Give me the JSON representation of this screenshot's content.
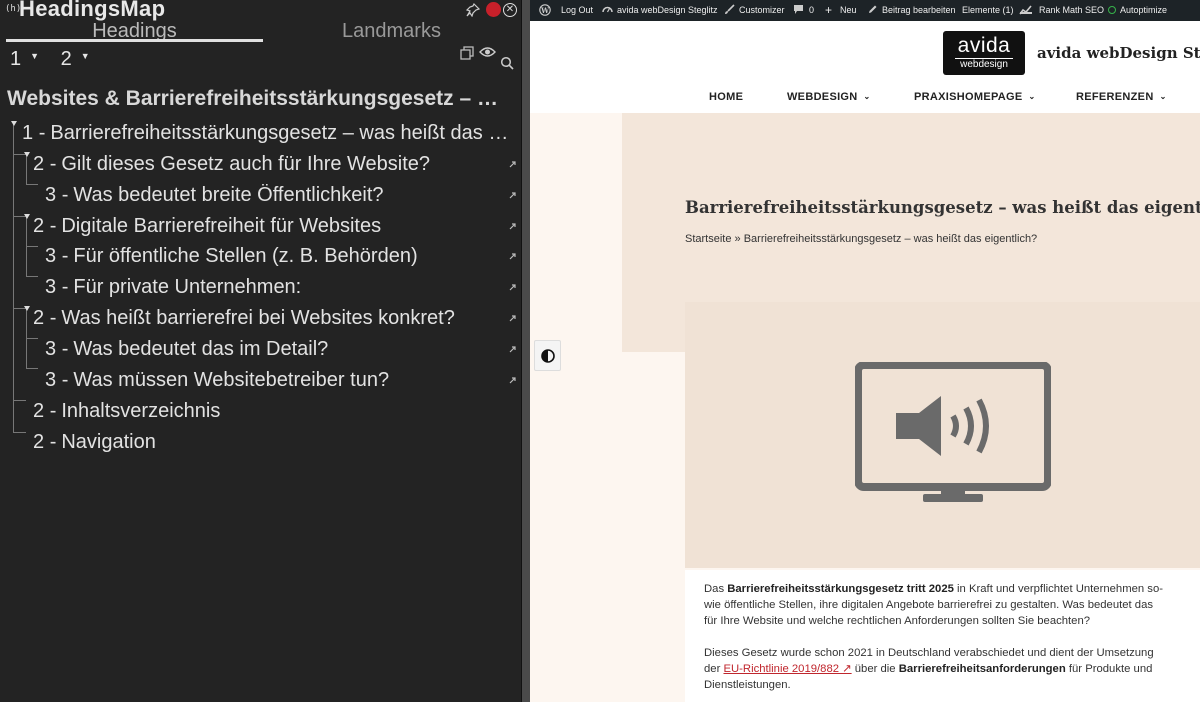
{
  "headingsmap": {
    "title": "HeadingsMap",
    "logo_text": "(h)",
    "tabs": [
      {
        "label": "Headings",
        "active": true
      },
      {
        "label": "Landmarks",
        "active": false
      }
    ],
    "level_buttons": [
      "1",
      "2"
    ],
    "document_title": "Websites & Barrierefreiheitsstärkungsgesetz – Was bedeutet das?",
    "headings": [
      {
        "level": "1",
        "text": "Barrierefreiheitsstärkungsgesetz – was heißt das eigentlich?"
      },
      {
        "level": "2",
        "text": "Gilt dieses Gesetz auch für Ihre Website?"
      },
      {
        "level": "3",
        "text": "Was bedeutet breite Öffentlichkeit?"
      },
      {
        "level": "2",
        "text": "Digitale Barrierefreiheit für Websites"
      },
      {
        "level": "3",
        "text": "Für öffentliche Stellen (z. B. Behörden)"
      },
      {
        "level": "3",
        "text": "Für private Unternehmen:"
      },
      {
        "level": "2",
        "text": "Was heißt barrierefrei bei Websites konkret?"
      },
      {
        "level": "3",
        "text": "Was bedeutet das im Detail?"
      },
      {
        "level": "3",
        "text": "Was müssen Websitebetreiber tun?"
      },
      {
        "level": "2",
        "text": "Inhaltsverzeichnis"
      },
      {
        "level": "2",
        "text": "Navigation"
      }
    ],
    "separator": "-",
    "icons": [
      "pin-icon",
      "record-icon",
      "close-icon",
      "copy-icon",
      "eye-icon",
      "search-icon",
      "link-icon"
    ]
  },
  "adminbar": {
    "logout": "Log Out",
    "site": "avida webDesign Steglitz",
    "customizer": "Customizer",
    "comments": "0",
    "new": "Neu",
    "edit": "Beitrag bearbeiten",
    "elements": "Elemente (1)",
    "rankmath": "Rank Math SEO",
    "autoptimize": "Autoptimize"
  },
  "site": {
    "logo_main": "avida",
    "logo_sub": "webdesign",
    "name": "avida webDesign Steglitz",
    "nav": [
      "HOME",
      "WEBDESIGN",
      "PRAXISHOMEPAGE",
      "REFERENZEN"
    ],
    "chevron": "⌄",
    "article_title": "Barrierefreiheitsstärkungsgesetz – was heißt das eigentlich?",
    "breadcrumb": "Startseite » Barrierefreiheitsstärkungsgesetz – was heißt das eigentlich?",
    "para1": {
      "t1": "Das ",
      "b1": "Barrierefreiheitsstärkungsgesetz tritt 2025",
      "t2": " in Kraft und verpflichtet Unternehmen so-",
      "line2": "wie öffentliche Stellen, ihre digitalen Angebote barrierefrei zu gestalten. Was bedeutet das",
      "line3": "für Ihre Website und welche rechtlichen Anforderungen sollten Sie beachten?"
    },
    "para2": {
      "line1": "Dieses Gesetz wurde schon  2021 in Deutschland verabschiedet und dient der Umsetzung",
      "t1": "der ",
      "link": "EU-Richtlinie 2019/882 ↗",
      "t2": " über die ",
      "b1": "Barrierefreiheitsanforderungen",
      "t3": " für Produkte und",
      "line3": "Dienstleistungen."
    },
    "colors": {
      "adminbar": "#1d2327",
      "hero": "#f3e6da",
      "accent_link": "#c0262d",
      "panel": "#232323"
    }
  }
}
